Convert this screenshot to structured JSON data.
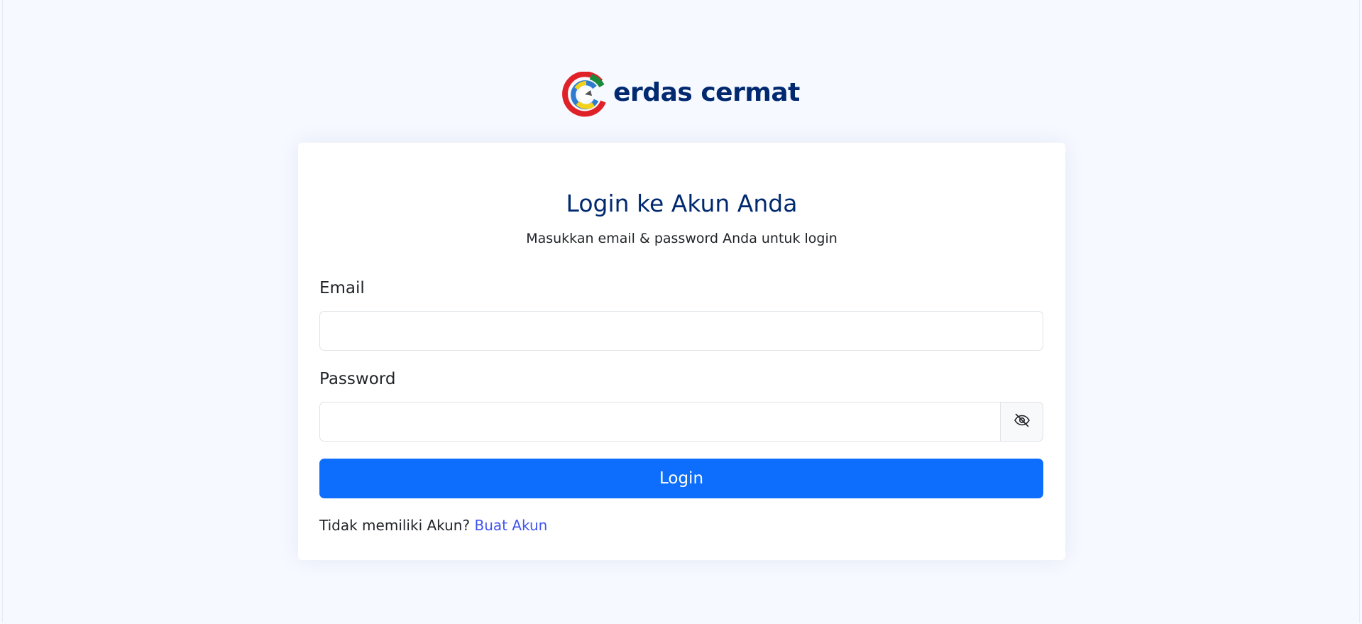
{
  "brand": {
    "name": "erdas cermat",
    "logo_icon": "cerdas-cermat-logo",
    "colors": {
      "navy": "#012970",
      "logo_red": "#e02228",
      "logo_green": "#1a8a3b",
      "logo_blue": "#2f7ccf",
      "logo_yellow": "#f2d21c"
    }
  },
  "login_card": {
    "title": "Login ke Akun Anda",
    "subtitle": "Masukkan email & password Anda untuk login",
    "email_label": "Email",
    "email_value": "",
    "password_label": "Password",
    "password_value": "",
    "password_toggle_icon": "eye-slash-icon",
    "login_button_label": "Login",
    "no_account_text": "Tidak memiliki Akun?",
    "create_account_link": "Buat Akun"
  },
  "colors": {
    "page_background": "#f6f9ff",
    "primary_button": "#0d6efd",
    "link": "#4154f1"
  }
}
